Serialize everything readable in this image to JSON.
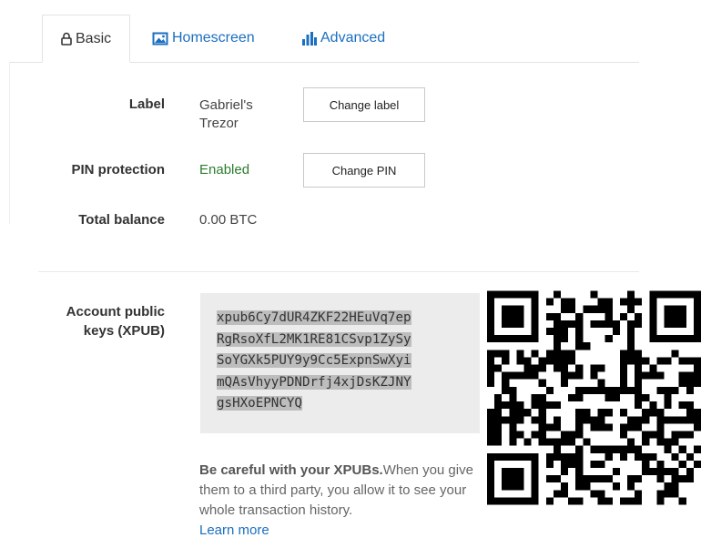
{
  "tabs": [
    {
      "label": "Basic",
      "icon": "lock-icon",
      "active": true
    },
    {
      "label": "Homescreen",
      "icon": "image-icon",
      "active": false
    },
    {
      "label": "Advanced",
      "icon": "bar-chart-icon",
      "active": false
    }
  ],
  "label_row": {
    "label": "Label",
    "value_line1": "Gabriel's",
    "value_line2": "Trezor",
    "button": "Change label"
  },
  "pin_row": {
    "label": "PIN protection",
    "value": "Enabled",
    "button": "Change PIN"
  },
  "balance_row": {
    "label": "Total balance",
    "value": "0.00 BTC"
  },
  "xpub": {
    "label_line1": "Account public",
    "label_line2": "keys (XPUB)",
    "lines": [
      "xpub6Cy7dUR4ZKF22HEuVq7ep",
      "RgRsoXfL2MK1RE81CSvp1ZySy",
      "SoYGXk5PUY9y9Cc5ExpnSwXyi",
      "mQAsVhyyPDNDrfj4xjDsKZJNY",
      "gsHXoEPNCYQ"
    ],
    "warning_bold": "Be careful with your XPUBs.",
    "warning_text": "When you give them to a third party, you allow it to see your whole transaction history.",
    "learn_more": "Learn more"
  },
  "colors": {
    "link": "#1b6fc0",
    "enabled": "#2a7d2e",
    "xpub_bg": "#ececec"
  }
}
